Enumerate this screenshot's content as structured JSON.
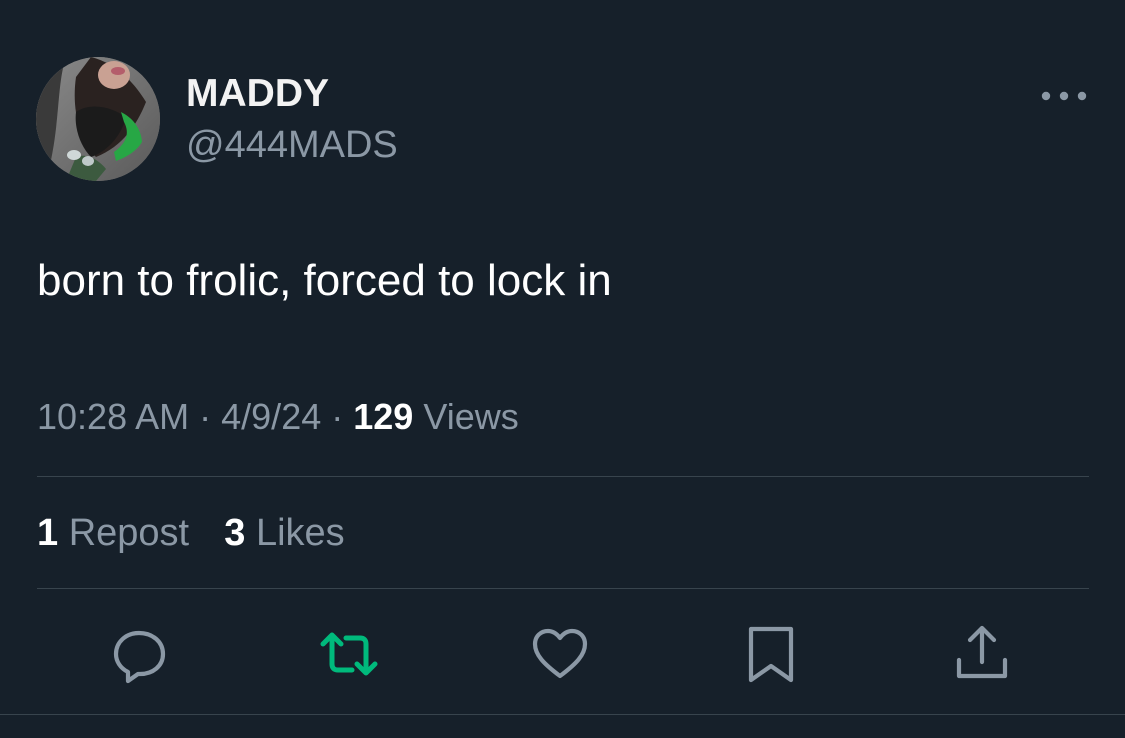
{
  "author": {
    "display_name": "MADDY",
    "handle": "@444MADS",
    "avatar_icon": "profile-photo"
  },
  "more_menu": {
    "icon": "more-horizontal-icon"
  },
  "tweet": {
    "text": "born to frolic, forced to lock in",
    "time": "10:28 AM",
    "separator": "·",
    "date": "4/9/24",
    "views_count": "129",
    "views_label": "Views"
  },
  "stats": {
    "reposts_count": "1",
    "reposts_label": "Repost",
    "likes_count": "3",
    "likes_label": "Likes"
  },
  "actions": [
    {
      "name": "reply",
      "icon": "reply-bubble-icon"
    },
    {
      "name": "repost",
      "icon": "repost-arrows-icon"
    },
    {
      "name": "like",
      "icon": "heart-icon"
    },
    {
      "name": "bookmark",
      "icon": "bookmark-icon"
    },
    {
      "name": "share",
      "icon": "share-upload-icon"
    }
  ],
  "colors": {
    "background": "#16202a",
    "text_primary": "#ffffff",
    "text_secondary": "#8b98a5",
    "divider": "#38444d",
    "repost_active": "#00ba7c",
    "icon_default": "#8b98a5"
  }
}
